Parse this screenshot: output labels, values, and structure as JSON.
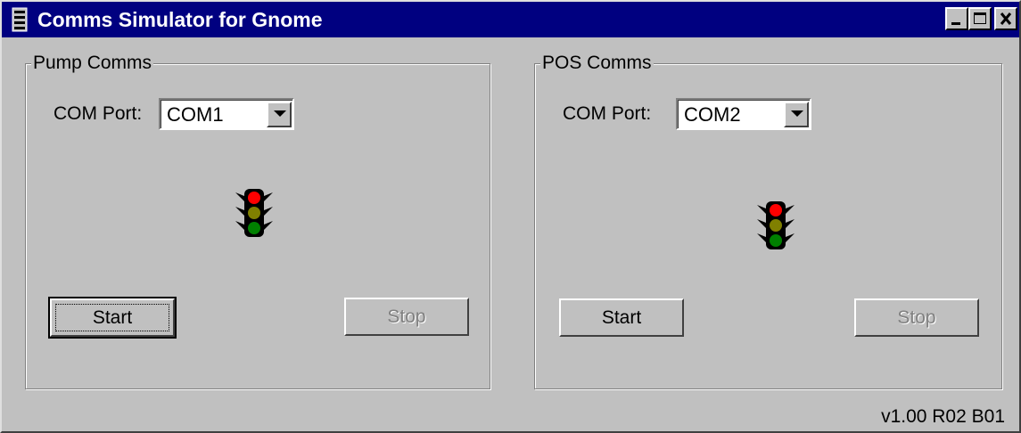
{
  "window": {
    "title": "Comms Simulator for Gnome"
  },
  "title_buttons": {
    "minimize": "minimize",
    "maximize": "maximize",
    "close": "close"
  },
  "pump": {
    "group_label": "Pump Comms",
    "port_label": "COM Port:",
    "port_value": "COM1",
    "start_label": "Start",
    "stop_label": "Stop"
  },
  "pos": {
    "group_label": "POS Comms",
    "port_label": "COM Port:",
    "port_value": "COM2",
    "start_label": "Start",
    "stop_label": "Stop"
  },
  "version": "v1.00 R02 B01",
  "colors": {
    "titlebar": "#000080",
    "face": "#c0c0c0",
    "light_red": "#ff0000",
    "light_amber": "#808000",
    "light_green": "#008000"
  },
  "icons": [
    "app-icon",
    "minimize-icon",
    "maximize-icon",
    "close-icon",
    "dropdown-arrow-icon",
    "traffic-light-icon"
  ]
}
